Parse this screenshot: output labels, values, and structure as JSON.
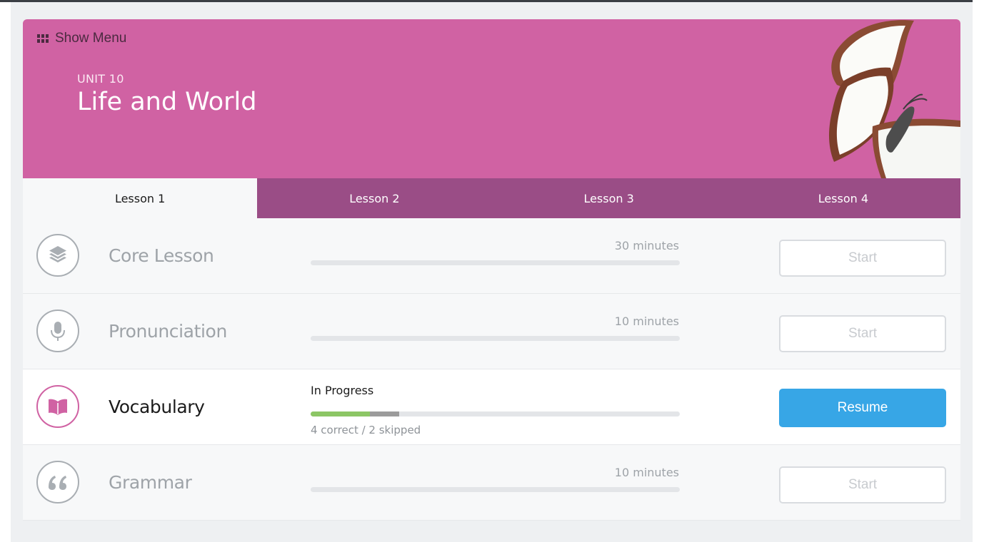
{
  "header": {
    "menu_label": "Show Menu",
    "unit_label": "UNIT 10",
    "unit_title": "Life and World"
  },
  "tabs": [
    {
      "label": "Lesson 1",
      "active": true
    },
    {
      "label": "Lesson 2",
      "active": false
    },
    {
      "label": "Lesson 3",
      "active": false
    },
    {
      "label": "Lesson 4",
      "active": false
    }
  ],
  "activities": [
    {
      "title": "Core Lesson",
      "icon": "layers-icon",
      "duration": "30 minutes",
      "button": "Start"
    },
    {
      "title": "Pronunciation",
      "icon": "microphone-icon",
      "duration": "10 minutes",
      "button": "Start"
    },
    {
      "title": "Vocabulary",
      "icon": "book-icon",
      "status": "In Progress",
      "progress_correct": 0.16,
      "progress_skipped": 0.08,
      "summary": "4 correct / 2 skipped",
      "button": "Resume"
    },
    {
      "title": "Grammar",
      "icon": "quote-icon",
      "duration": "10 minutes",
      "button": "Start"
    }
  ],
  "colors": {
    "hero": "#d062a3",
    "tab_bar": "#9a4d86",
    "accent": "#37a6e6",
    "progress_correct": "#8cc665",
    "progress_skipped": "#9b9b9b"
  }
}
